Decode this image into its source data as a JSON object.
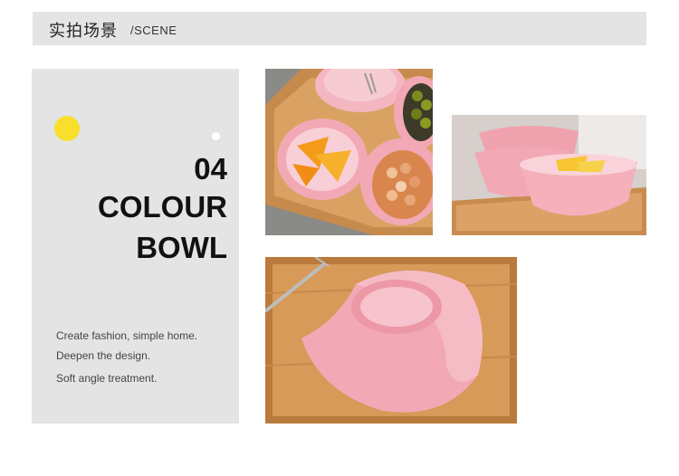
{
  "header": {
    "title": "实拍场景",
    "subtitle": "/SCENE"
  },
  "feature": {
    "number": "04",
    "line1": "COLOUR",
    "line2": "BOWL",
    "descriptions": [
      "Create fashion, simple home.",
      "Deepen the design.",
      "Soft angle treatment."
    ]
  },
  "colors": {
    "accent_dot": "#f7df2b",
    "panel_bg": "#e4e4e4",
    "bowl_pink": "#f2a9b5"
  },
  "photos": [
    {
      "name": "photo-bowls-with-fruit"
    },
    {
      "name": "photo-stacked-bowls"
    },
    {
      "name": "photo-upturned-bowl"
    }
  ]
}
